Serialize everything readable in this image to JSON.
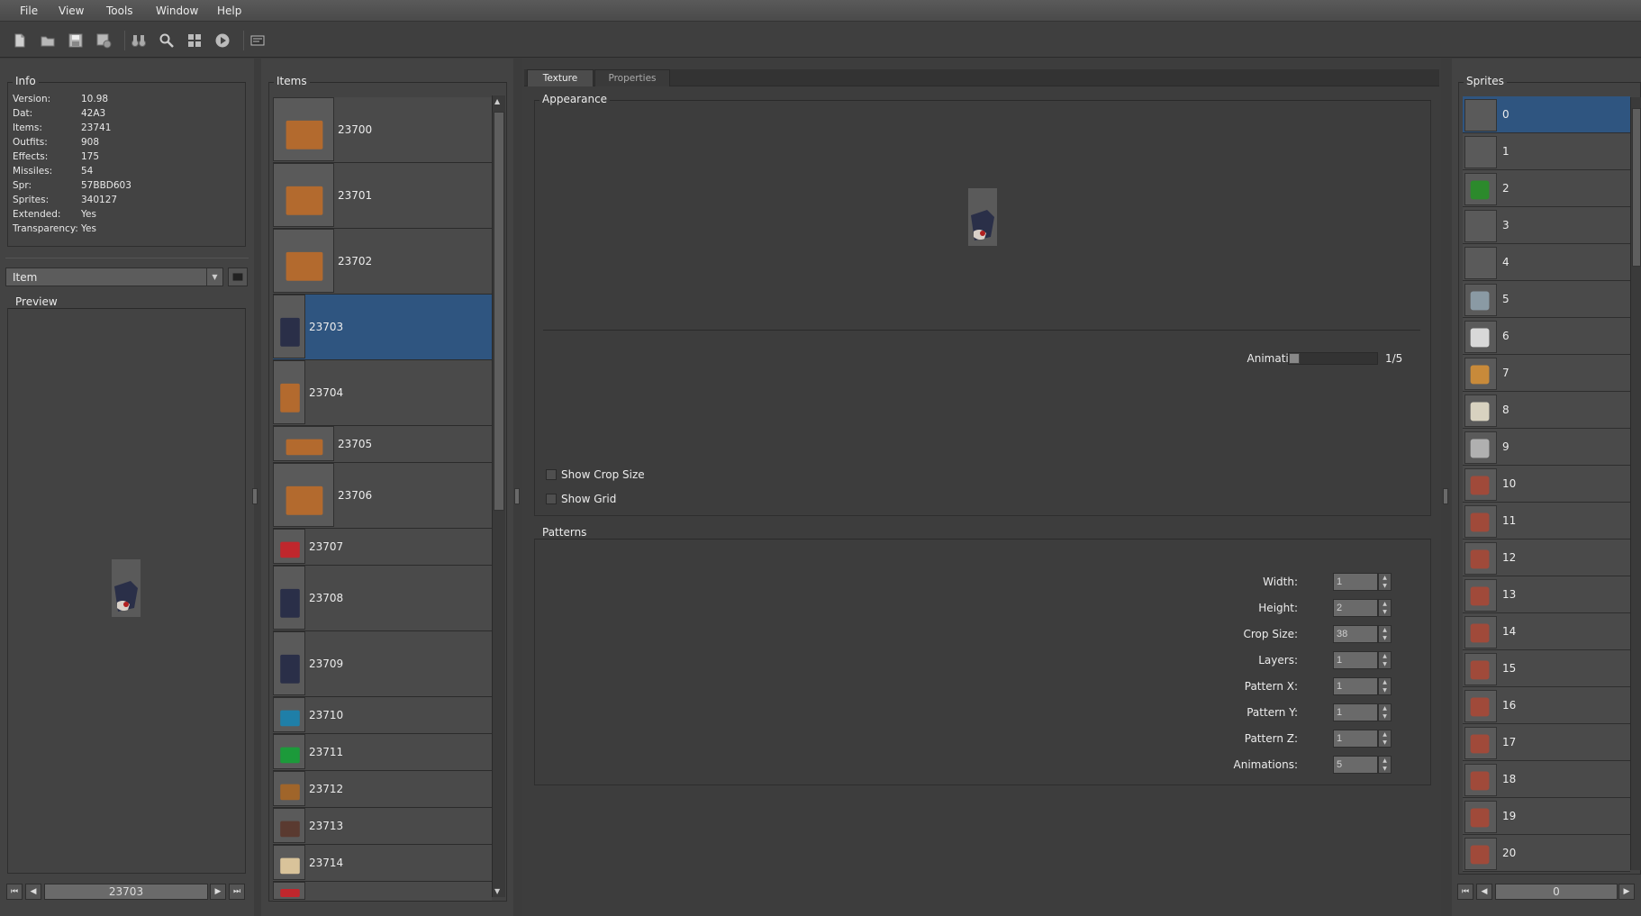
{
  "menu": [
    "File",
    "View",
    "Tools",
    "Window",
    "Help"
  ],
  "toolbar_icons": [
    "new-file-icon",
    "open-folder-icon",
    "save-icon",
    "save-as-icon",
    "binoculars-icon",
    "search-icon",
    "grid-icon",
    "play-icon",
    "log-window-icon"
  ],
  "info": {
    "title": "Info",
    "rows": [
      {
        "key": "Version:",
        "value": "10.98"
      },
      {
        "key": "Dat:",
        "value": "42A3"
      },
      {
        "key": "Items:",
        "value": "23741"
      },
      {
        "key": "Outfits:",
        "value": "908"
      },
      {
        "key": "Effects:",
        "value": "175"
      },
      {
        "key": "Missiles:",
        "value": "54"
      },
      {
        "key": "Spr:",
        "value": "57BBD603"
      },
      {
        "key": "Sprites:",
        "value": "340127"
      },
      {
        "key": "Extended:",
        "value": "Yes"
      },
      {
        "key": "Transparency:",
        "value": "Yes"
      }
    ]
  },
  "category_select": {
    "value": "Item"
  },
  "preview": {
    "title": "Preview"
  },
  "left_nav": {
    "value": "23703"
  },
  "items": {
    "title": "Items",
    "rows": [
      {
        "id": "23700",
        "h": 73,
        "thumb": "wide",
        "color": "#b36a2e"
      },
      {
        "id": "23701",
        "h": 73,
        "thumb": "wide",
        "color": "#b36a2e"
      },
      {
        "id": "23702",
        "h": 73,
        "thumb": "wide",
        "color": "#b36a2e"
      },
      {
        "id": "23703",
        "h": 73,
        "thumb": "narrow",
        "color": "#2a2f48",
        "selected": true
      },
      {
        "id": "23704",
        "h": 73,
        "thumb": "narrow",
        "color": "#b36a2e"
      },
      {
        "id": "23705",
        "h": 41,
        "thumb": "wide",
        "color": "#b36a2e"
      },
      {
        "id": "23706",
        "h": 73,
        "thumb": "wide",
        "color": "#b36a2e"
      },
      {
        "id": "23707",
        "h": 41,
        "thumb": "narrow",
        "color": "#c0272d"
      },
      {
        "id": "23708",
        "h": 73,
        "thumb": "narrow",
        "color": "#2a2f48"
      },
      {
        "id": "23709",
        "h": 73,
        "thumb": "narrow",
        "color": "#2a2f48"
      },
      {
        "id": "23710",
        "h": 41,
        "thumb": "narrow",
        "color": "#1f7fa8"
      },
      {
        "id": "23711",
        "h": 41,
        "thumb": "narrow",
        "color": "#1c9a3a"
      },
      {
        "id": "23712",
        "h": 41,
        "thumb": "narrow",
        "color": "#a0652a"
      },
      {
        "id": "23713",
        "h": 41,
        "thumb": "narrow",
        "color": "#5a3a30"
      },
      {
        "id": "23714",
        "h": 41,
        "thumb": "narrow",
        "color": "#d9c39a"
      },
      {
        "id": "",
        "h": 22,
        "thumb": "narrow",
        "color": "#c0272d"
      }
    ]
  },
  "tabs": [
    {
      "label": "Texture",
      "active": true
    },
    {
      "label": "Properties",
      "active": false
    }
  ],
  "appearance": {
    "title": "Appearance",
    "animations_label": "Animations:",
    "animations_value": "1/5",
    "animation_progress": 0.2,
    "show_crop_size": "Show Crop Size",
    "show_grid": "Show Grid"
  },
  "patterns": {
    "title": "Patterns",
    "fields": [
      {
        "label": "Width:",
        "value": "1"
      },
      {
        "label": "Height:",
        "value": "2"
      },
      {
        "label": "Crop Size:",
        "value": "38"
      },
      {
        "label": "Layers:",
        "value": "1"
      },
      {
        "label": "Pattern X:",
        "value": "1"
      },
      {
        "label": "Pattern Y:",
        "value": "1"
      },
      {
        "label": "Pattern Z:",
        "value": "1"
      },
      {
        "label": "Animations:",
        "value": "5"
      }
    ]
  },
  "sprites": {
    "title": "Sprites",
    "rows": [
      {
        "id": "0",
        "selected": true,
        "color": ""
      },
      {
        "id": "1",
        "color": ""
      },
      {
        "id": "2",
        "color": "#2c8a2c"
      },
      {
        "id": "3",
        "color": ""
      },
      {
        "id": "4",
        "color": ""
      },
      {
        "id": "5",
        "color": "#8a9aa4"
      },
      {
        "id": "6",
        "color": "#d8d8d8"
      },
      {
        "id": "7",
        "color": "#c88a3a"
      },
      {
        "id": "8",
        "color": "#d8d2c0"
      },
      {
        "id": "9",
        "color": "#b0b0b0"
      },
      {
        "id": "10",
        "color": "#a04a3a"
      },
      {
        "id": "11",
        "color": "#a04a3a"
      },
      {
        "id": "12",
        "color": "#a04a3a"
      },
      {
        "id": "13",
        "color": "#a04a3a"
      },
      {
        "id": "14",
        "color": "#a04a3a"
      },
      {
        "id": "15",
        "color": "#a04a3a"
      },
      {
        "id": "16",
        "color": "#a04a3a"
      },
      {
        "id": "17",
        "color": "#a04a3a"
      },
      {
        "id": "18",
        "color": "#a04a3a"
      },
      {
        "id": "19",
        "color": "#a04a3a"
      },
      {
        "id": "20",
        "color": "#a04a3a"
      }
    ]
  },
  "sprite_nav": {
    "value": "0"
  },
  "colors": {
    "selection": "#2f5580",
    "panel": "#434343"
  }
}
